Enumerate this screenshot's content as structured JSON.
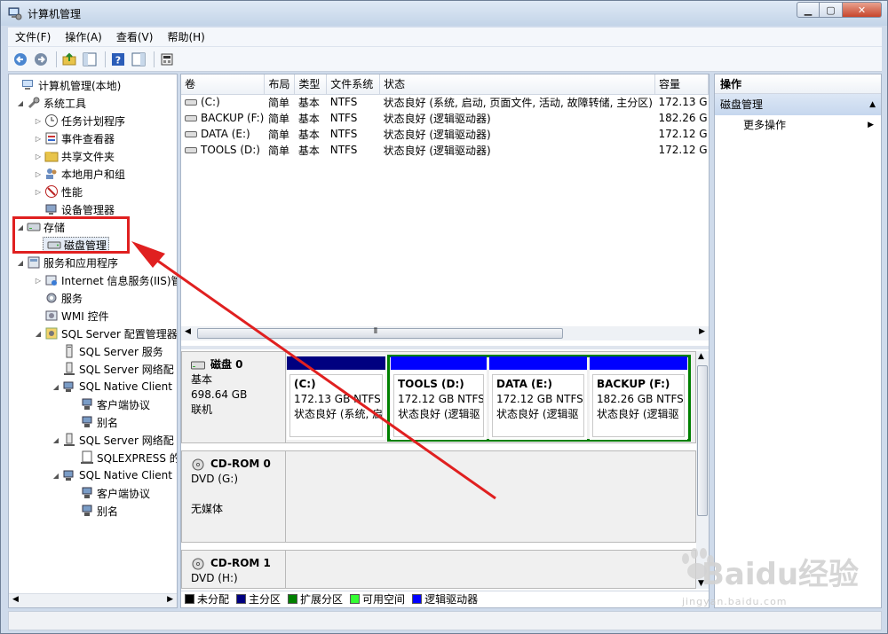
{
  "window": {
    "title": "计算机管理"
  },
  "menu": [
    "文件(F)",
    "操作(A)",
    "查看(V)",
    "帮助(H)"
  ],
  "toolbar": [
    "back-icon",
    "forward-icon",
    "up-folder-icon",
    "show-tree-icon",
    "help-icon",
    "properties-icon",
    "console-icon"
  ],
  "tree": {
    "root": "计算机管理(本地)",
    "system_tools": "系统工具",
    "task_scheduler": "任务计划程序",
    "event_viewer": "事件查看器",
    "shared_folders": "共享文件夹",
    "local_users": "本地用户和组",
    "performance": "性能",
    "device_manager": "设备管理器",
    "storage": "存储",
    "disk_management": "磁盘管理",
    "services_apps": "服务和应用程序",
    "iis": "Internet 信息服务(IIS)管",
    "services": "服务",
    "wmi": "WMI 控件",
    "sql_config": "SQL Server 配置管理器",
    "sql_services": "SQL Server 服务",
    "sql_network1": "SQL Server 网络配",
    "native_client1": "SQL Native Client",
    "client_protocols1": "客户端协议",
    "alias1": "别名",
    "sql_network2": "SQL Server 网络配",
    "sqlexpress": "SQLEXPRESS 的",
    "native_client2": "SQL Native Client",
    "client_protocols2": "客户端协议",
    "alias2": "别名"
  },
  "volumes": {
    "headers": [
      "卷",
      "布局",
      "类型",
      "文件系统",
      "状态",
      "容量"
    ],
    "rows": [
      [
        "(C:)",
        "简单",
        "基本",
        "NTFS",
        "状态良好 (系统, 启动, 页面文件, 活动, 故障转储, 主分区)",
        "172.13 G"
      ],
      [
        "BACKUP (F:)",
        "简单",
        "基本",
        "NTFS",
        "状态良好 (逻辑驱动器)",
        "182.26 G"
      ],
      [
        "DATA (E:)",
        "简单",
        "基本",
        "NTFS",
        "状态良好 (逻辑驱动器)",
        "172.12 G"
      ],
      [
        "TOOLS (D:)",
        "简单",
        "基本",
        "NTFS",
        "状态良好 (逻辑驱动器)",
        "172.12 G"
      ]
    ]
  },
  "disks": {
    "disk0": {
      "name": "磁盘 0",
      "type": "基本",
      "size": "698.64 GB",
      "status": "联机"
    },
    "cd0": {
      "name": "CD-ROM 0",
      "drive": "DVD (G:)",
      "status": "无媒体"
    },
    "cd1": {
      "name": "CD-ROM 1",
      "drive": "DVD (H:)"
    }
  },
  "partitions": {
    "c": {
      "name": "(C:)",
      "size": "172.13 GB NTFS",
      "status": "状态良好 (系统, 启"
    },
    "d": {
      "name": "TOOLS  (D:)",
      "size": "172.12 GB NTFS",
      "status": "状态良好 (逻辑驱"
    },
    "e": {
      "name": "DATA  (E:)",
      "size": "172.12 GB NTFS",
      "status": "状态良好 (逻辑驱"
    },
    "f": {
      "name": "BACKUP  (F:)",
      "size": "182.26 GB NTFS",
      "status": "状态良好 (逻辑驱"
    }
  },
  "legend": [
    {
      "label": "未分配",
      "color": "#000000"
    },
    {
      "label": "主分区",
      "color": "#000080"
    },
    {
      "label": "扩展分区",
      "color": "#008000"
    },
    {
      "label": "可用空间",
      "color": "#33ff33"
    },
    {
      "label": "逻辑驱动器",
      "color": "#0000ff"
    }
  ],
  "actions": {
    "header": "操作",
    "section": "磁盘管理",
    "more": "更多操作"
  },
  "watermark": {
    "brand": "Baidu经验",
    "url": "jingyan.baidu.com"
  },
  "colors": {
    "primary_partition": "#000080",
    "logical_drive": "#0000ff",
    "extended_partition": "#008000",
    "annotation_red": "#e02020"
  }
}
